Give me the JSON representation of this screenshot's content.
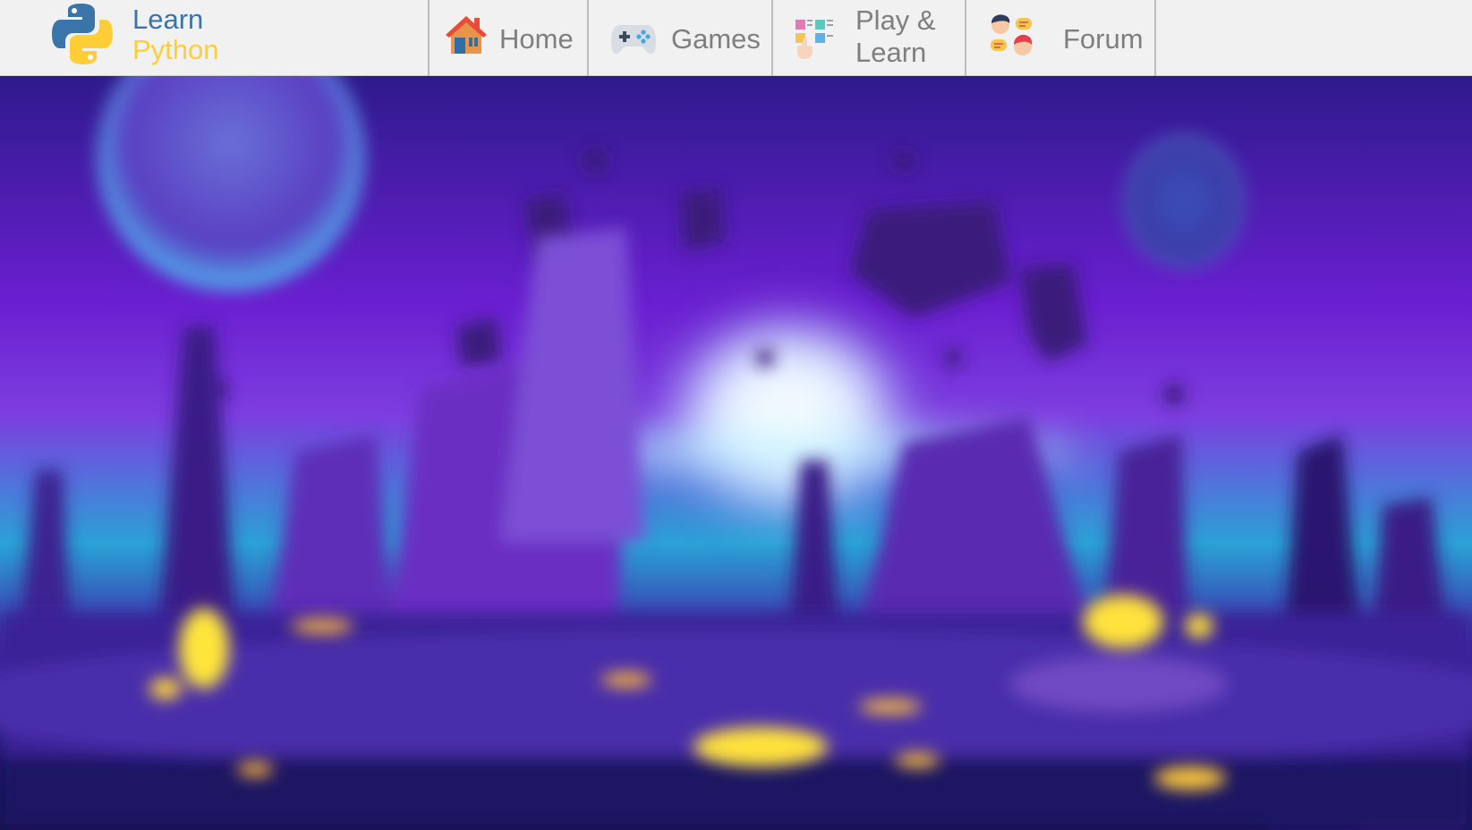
{
  "logo": {
    "line1": "Learn",
    "line2": "Python",
    "icon": "python-logo-icon",
    "colors": {
      "blue": "#3a74a8",
      "yellow": "#ffcd36"
    }
  },
  "nav": {
    "items": [
      {
        "label": "Home",
        "icon": "house-icon"
      },
      {
        "label": "Games",
        "icon": "gamepad-icon"
      },
      {
        "label_line1": "Play &",
        "label_line2": "Learn",
        "icon": "alphabet-blocks-icon"
      },
      {
        "label": "Forum",
        "icon": "chat-people-icon"
      }
    ],
    "label_color": "#7f7f7f"
  },
  "hero": {
    "description_icon": "space-landscape-image"
  }
}
